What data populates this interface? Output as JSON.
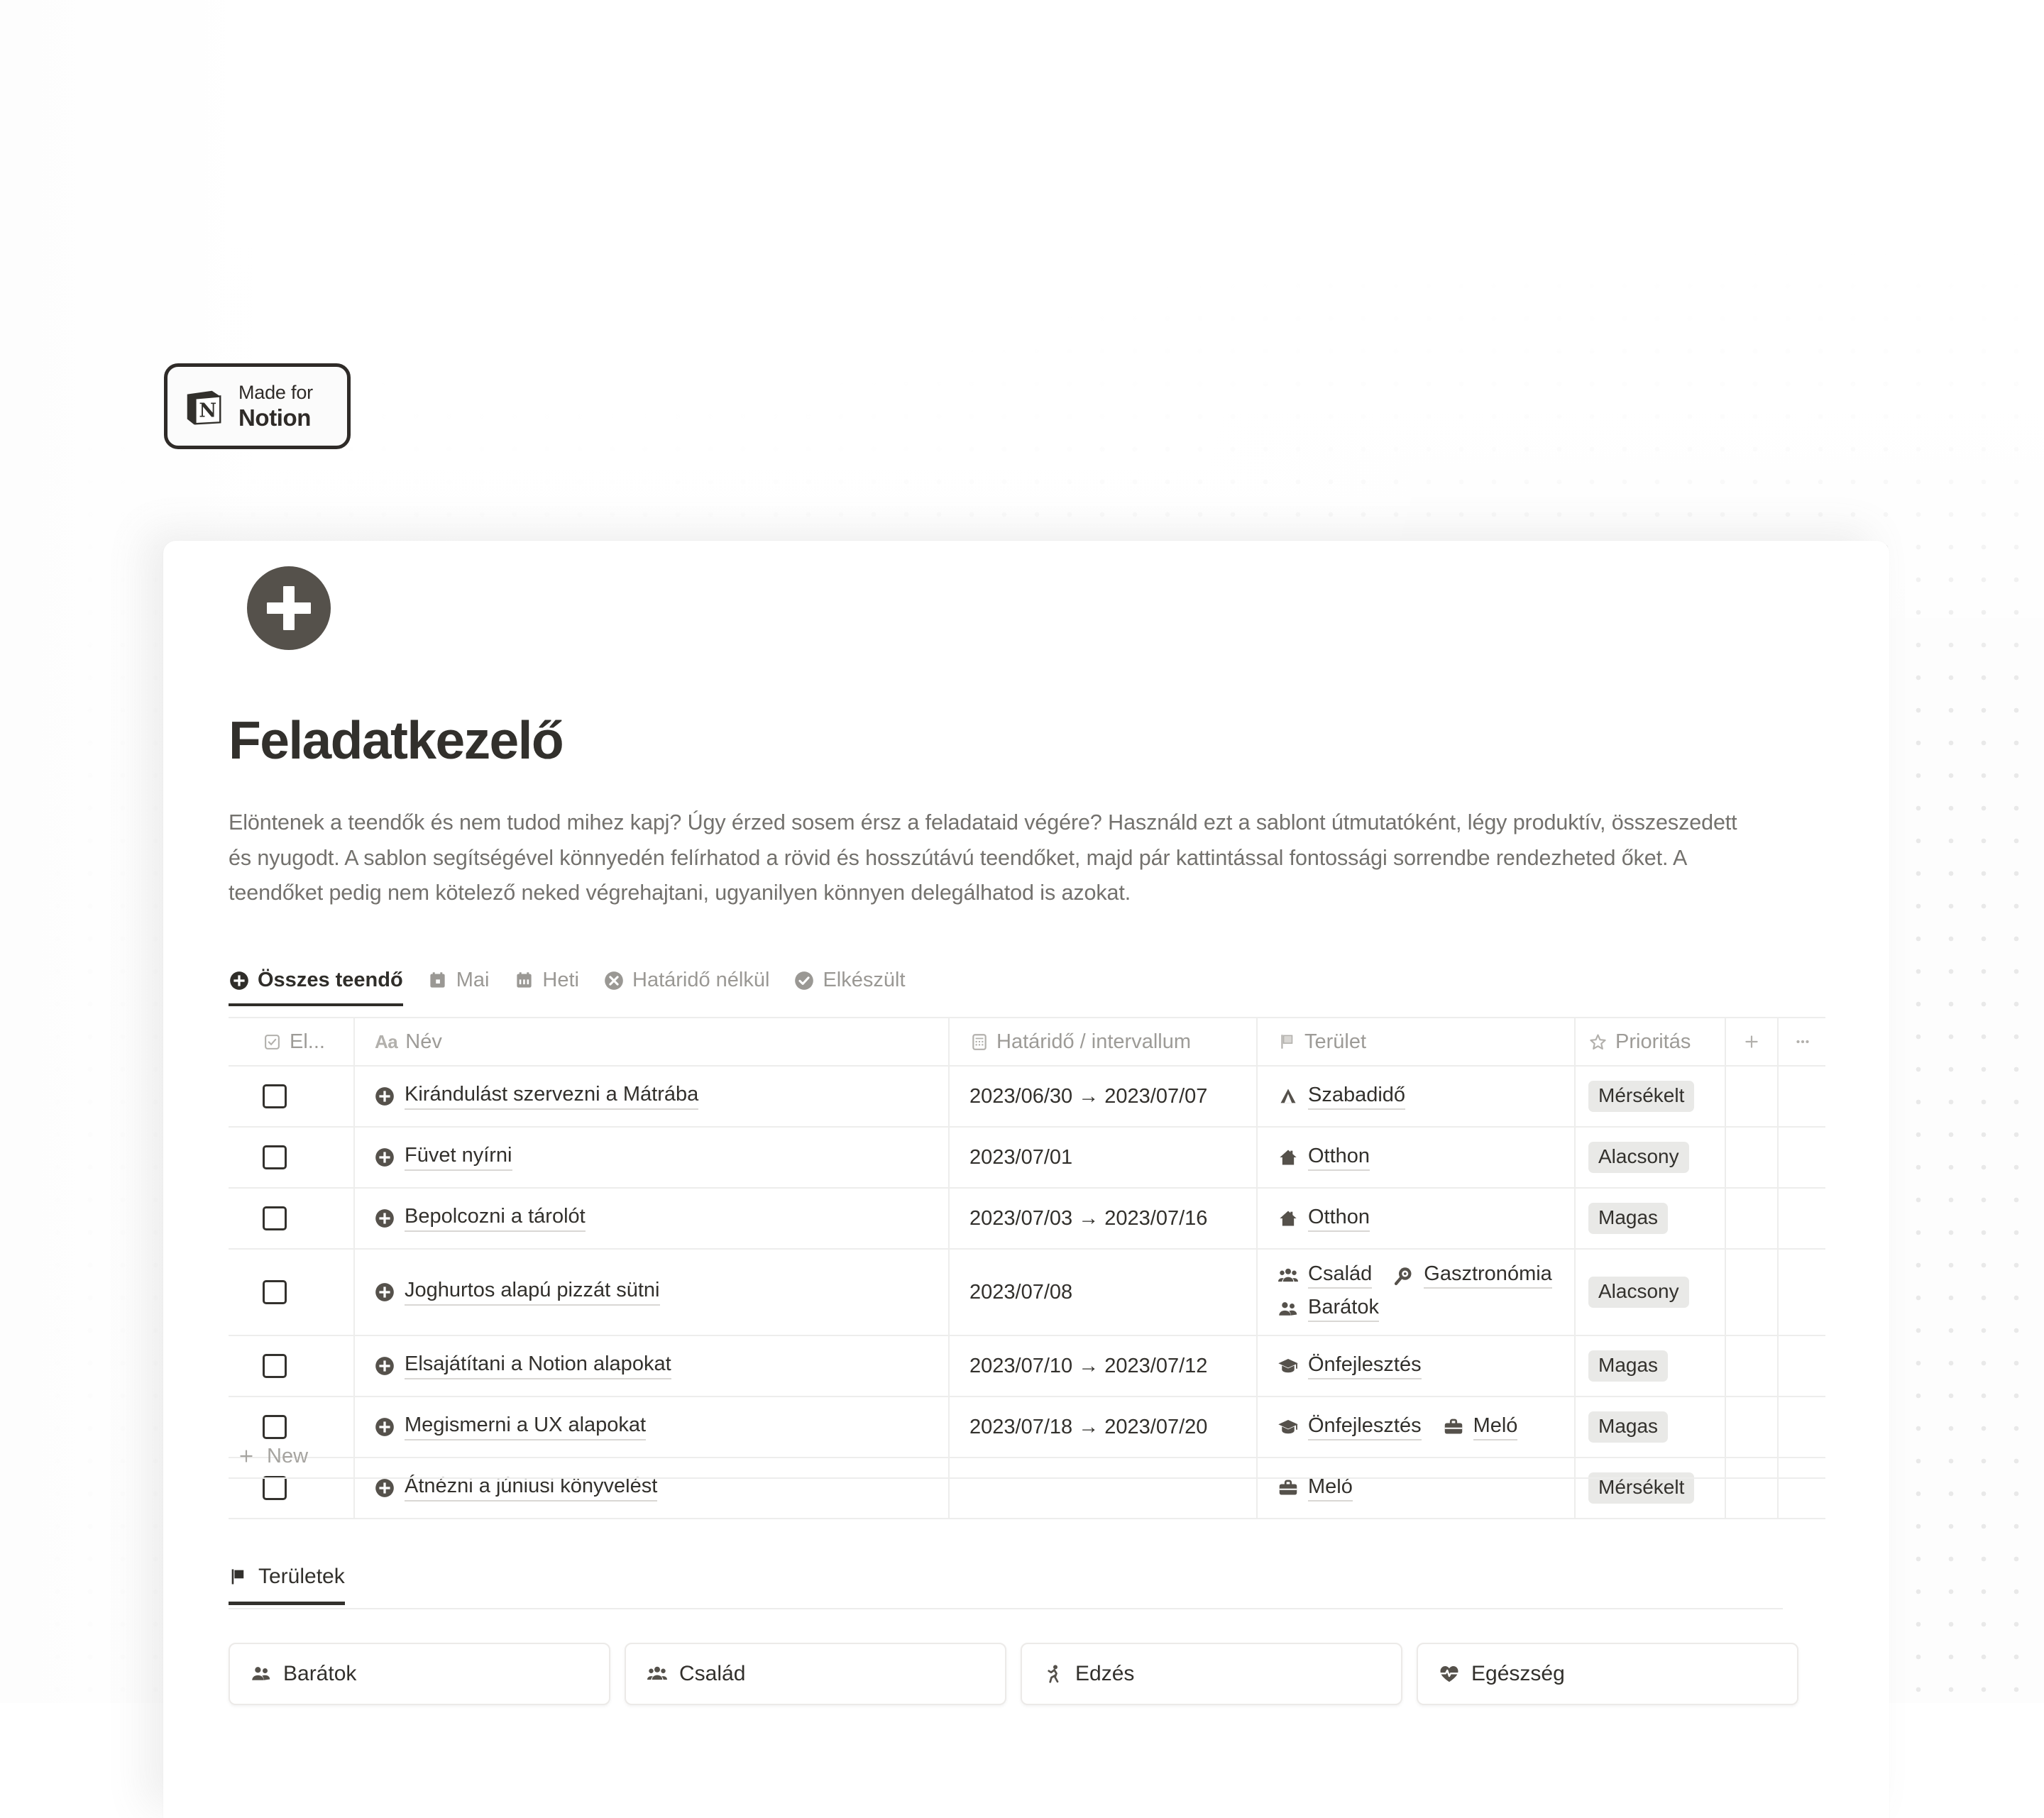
{
  "badge": {
    "made_for": "Made for",
    "brand": "Notion"
  },
  "page": {
    "icon": "plus-circle-icon",
    "title": "Feladatkezelő",
    "description": "Elöntenek a teendők és nem tudod mihez kapj? Úgy érzed sosem érsz a feladataid végére? Használd ezt a sablont útmutatóként, légy produktív, összeszedett és nyugodt. A sablon segítségével könnyedén felírhatod a rövid és hosszútávú teendőket, majd pár kattintással fontossági sorrendbe rendezheted őket. A teendőket pedig nem kötelező neked végrehajtani, ugyanilyen könnyen delegálhatod is azokat."
  },
  "tabs": [
    {
      "label": "Összes teendő",
      "icon": "plus-circle-icon",
      "active": true
    },
    {
      "label": "Mai",
      "icon": "calendar-today-icon",
      "active": false
    },
    {
      "label": "Heti",
      "icon": "calendar-week-icon",
      "active": false
    },
    {
      "label": "Határidő nélkül",
      "icon": "x-circle-icon",
      "active": false
    },
    {
      "label": "Elkészült",
      "icon": "check-circle-icon",
      "active": false
    }
  ],
  "table": {
    "headers": {
      "check": "El...",
      "name": "Név",
      "name_type": "Aa",
      "date": "Határidő / intervallum",
      "area": "Terület",
      "priority": "Prioritás",
      "add": "+",
      "more": "•••"
    },
    "rows": [
      {
        "name": "Kirándulást szervezni a Mátrába",
        "date": "2023/06/30 → 2023/07/07",
        "areas": [
          {
            "label": "Szabadidő",
            "icon": "tent-icon"
          }
        ],
        "priority": "Mérsékelt"
      },
      {
        "name": "Füvet nyírni",
        "date": "2023/07/01",
        "areas": [
          {
            "label": "Otthon",
            "icon": "home-icon"
          }
        ],
        "priority": "Alacsony"
      },
      {
        "name": "Bepolcozni a tárolót",
        "date": "2023/07/03 → 2023/07/16",
        "areas": [
          {
            "label": "Otthon",
            "icon": "home-icon"
          }
        ],
        "priority": "Magas"
      },
      {
        "name": "Joghurtos alapú pizzát sütni",
        "date": "2023/07/08",
        "areas": [
          {
            "label": "Család",
            "icon": "people-group-icon"
          },
          {
            "label": "Gasztronómia",
            "icon": "food-search-icon"
          },
          {
            "label": "Barátok",
            "icon": "people-pair-icon"
          }
        ],
        "priority": "Alacsony"
      },
      {
        "name": "Elsajátítani a Notion alapokat",
        "date": "2023/07/10 → 2023/07/12",
        "areas": [
          {
            "label": "Önfejlesztés",
            "icon": "graduation-cap-icon"
          }
        ],
        "priority": "Magas"
      },
      {
        "name": "Megismerni a UX alapokat",
        "date": "2023/07/18 → 2023/07/20",
        "areas": [
          {
            "label": "Önfejlesztés",
            "icon": "graduation-cap-icon"
          },
          {
            "label": "Meló",
            "icon": "briefcase-icon"
          }
        ],
        "priority": "Magas"
      },
      {
        "name": "Átnézni a júniusi könyvelést",
        "date": "",
        "areas": [
          {
            "label": "Meló",
            "icon": "briefcase-icon"
          }
        ],
        "priority": "Mérsékelt"
      }
    ],
    "new_row_label": "New"
  },
  "areas_section": {
    "title": "Területek",
    "icon": "flag-icon",
    "cards": [
      {
        "label": "Barátok",
        "icon": "people-pair-icon"
      },
      {
        "label": "Család",
        "icon": "people-group-icon"
      },
      {
        "label": "Edzés",
        "icon": "running-icon"
      },
      {
        "label": "Egészség",
        "icon": "heart-pulse-icon"
      }
    ]
  },
  "colors": {
    "text_dark": "#32302c",
    "text_muted": "#73716d",
    "icon_dark": "#55514b",
    "pill_bg": "#e9e9e7",
    "border": "#ededec"
  }
}
